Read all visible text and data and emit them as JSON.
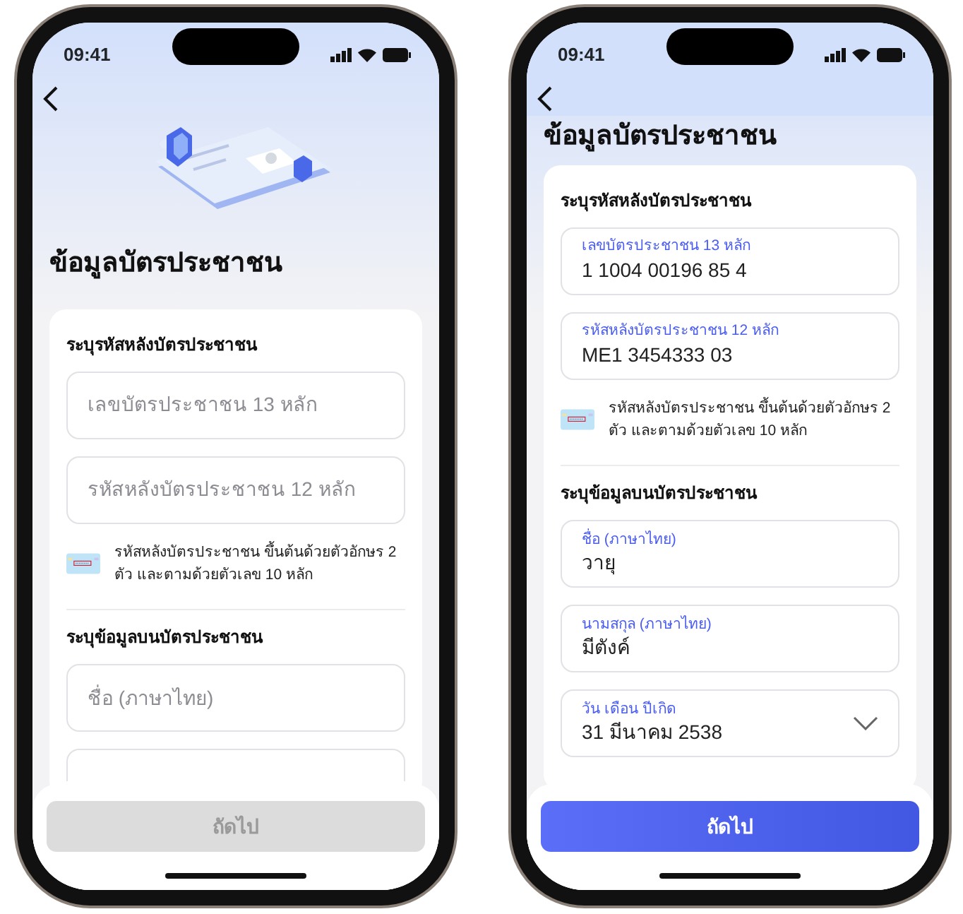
{
  "phones": [
    {
      "status_time": "09:41",
      "illustration": true,
      "title": "ข้อมูลบัตรประชาชน",
      "sections": [
        {
          "heading": "ระบุรหัสหลังบัตรประชาชน",
          "fields": [
            {
              "kind": "text",
              "placeholder": "เลขบัตรประชาชน 13 หลัก"
            },
            {
              "kind": "text",
              "placeholder": "รหัสหลังบัตรประชาชน 12 หลัก"
            }
          ],
          "hint": "รหัสหลังบัตรประชาชน ขึ้นต้นด้วยตัวอักษร 2 ตัว และตามด้วยตัวเลข 10 หลัก"
        },
        {
          "heading": "ระบุข้อมูลบนบัตรประชาชน",
          "fields": [
            {
              "kind": "text",
              "placeholder": "ชื่อ (ภาษาไทย)"
            },
            {
              "kind": "text"
            }
          ]
        }
      ],
      "button": {
        "label": "ถัดไป",
        "disabled": true
      }
    },
    {
      "status_time": "09:41",
      "illustration": false,
      "title": "ข้อมูลบัตรประชาชน",
      "sections": [
        {
          "heading": "ระบุรหัสหลังบัตรประชาชน",
          "fields": [
            {
              "kind": "text",
              "label": "เลขบัตรประชาชน 13 หลัก",
              "value": "1 1004 00196 85 4"
            },
            {
              "kind": "text",
              "label": "รหัสหลังบัตรประชาชน 12 หลัก",
              "value": "ME1 3454333 03"
            }
          ],
          "hint": "รหัสหลังบัตรประชาชน ขึ้นต้นด้วยตัวอักษร 2 ตัว และตามด้วยตัวเลข 10 หลัก"
        },
        {
          "heading": "ระบุข้อมูลบนบัตรประชาชน",
          "fields": [
            {
              "kind": "text",
              "label": "ชื่อ (ภาษาไทย)",
              "value": "วายุ"
            },
            {
              "kind": "text",
              "label": "นามสกุล (ภาษาไทย)",
              "value": "มีตังค์"
            },
            {
              "kind": "date",
              "label": "วัน เดือน ปีเกิด",
              "value": "31 มีนาคม 2538"
            }
          ]
        }
      ],
      "button": {
        "label": "ถัดไป",
        "disabled": false
      }
    }
  ]
}
